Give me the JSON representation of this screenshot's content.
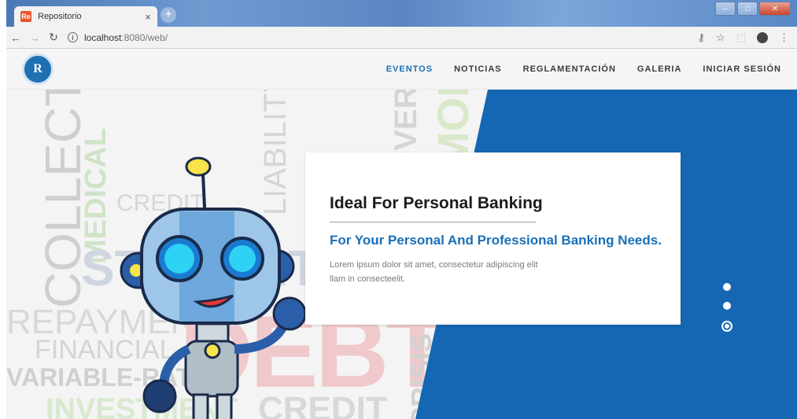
{
  "browser": {
    "tab_title": "Repositorio",
    "tab_close": "×",
    "new_tab": "+",
    "favicon": "Re",
    "url_host": "localhost",
    "url_rest": ":8080/web/",
    "icons": [
      "back-icon",
      "forward-icon",
      "reload-icon",
      "info-icon",
      "key-icon",
      "star-icon",
      "extension-icon",
      "profile-icon",
      "menu-icon"
    ]
  },
  "site": {
    "logo_text": "R",
    "menu": [
      {
        "label": "EVENTOS",
        "active": true
      },
      {
        "label": "NOTICIAS",
        "active": false
      },
      {
        "label": "REGLAMENTACIÓN",
        "active": false
      },
      {
        "label": "GALERIA",
        "active": false
      },
      {
        "label": "INICIAR SESIÓN",
        "active": false
      }
    ]
  },
  "hero": {
    "title": "Ideal For Personal Banking",
    "subtitle": "For Your Personal And Professional Banking Needs.",
    "body_line1": "Lorem ipsum dolor sit amet, consectetur adipiscing elit",
    "body_line2": "llam in consecteelit.",
    "slide_count": 3,
    "active_slide": 3,
    "background_words": [
      "COLLECTION",
      "MEDICAL",
      "CREDIT",
      "STUDENT",
      "REPAYMENT",
      "FINANCIAL",
      "VARIABLE-RATE",
      "INVESTMENT",
      "DEBT",
      "CREDIT",
      "CRISIS",
      "LIABILITY",
      "GOVERNMENT",
      "MORTGAGE"
    ],
    "accent_color": "#1567b3"
  }
}
